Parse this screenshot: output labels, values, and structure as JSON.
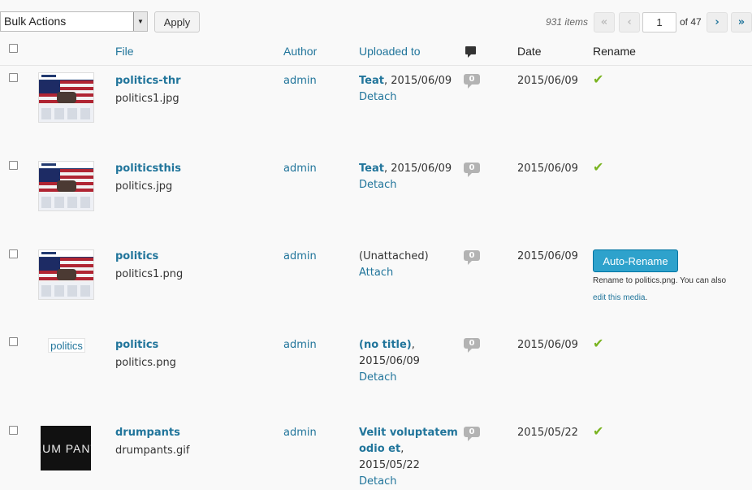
{
  "toolbar": {
    "bulk_actions": "Bulk Actions",
    "apply": "Apply",
    "items_count": "931 items",
    "first": "«",
    "prev": "‹",
    "current_page": "1",
    "of_total": "of 47",
    "next": "›",
    "last": "»"
  },
  "columns": {
    "file": "File",
    "author": "Author",
    "uploaded_to": "Uploaded to",
    "comments_icon": "comment-icon",
    "date": "Date",
    "rename": "Rename"
  },
  "rows": [
    {
      "title": "politics-thr",
      "filename": "politics1.jpg",
      "author": "admin",
      "uploaded_parent": "Teat",
      "uploaded_date": ", 2015/06/09",
      "uploaded_action": "Detach",
      "comments": "0",
      "date": "2015/06/09",
      "rename_status": "✔",
      "thumb": "politics-image"
    },
    {
      "title": "politicsthis",
      "filename": "politics.jpg",
      "author": "admin",
      "uploaded_parent": "Teat",
      "uploaded_date": ", 2015/06/09",
      "uploaded_action": "Detach",
      "comments": "0",
      "date": "2015/06/09",
      "rename_status": "✔",
      "thumb": "politics-image"
    },
    {
      "title": "politics",
      "filename": "politics1.png",
      "author": "admin",
      "uploaded_plain": "(Unattached)",
      "uploaded_action": "Attach",
      "comments": "0",
      "date": "2015/06/09",
      "rename_button": "Auto-Rename",
      "rename_note": "Rename to politics.png. You can also",
      "rename_link": "edit this media",
      "rename_link_suffix": ".",
      "thumb": "politics-image"
    },
    {
      "title": "politics",
      "filename": "politics.png",
      "author": "admin",
      "uploaded_parent": "(no title)",
      "uploaded_suffix": ",",
      "uploaded_date": "2015/06/09",
      "uploaded_action": "Detach",
      "comments": "0",
      "date": "2015/06/09",
      "rename_status": "✔",
      "thumb_text": "politics"
    },
    {
      "title": "drumpants",
      "filename": "drumpants.gif",
      "author": "admin",
      "uploaded_parent_line1": "Velit voluptatem",
      "uploaded_parent_line2": "odio et",
      "uploaded_date": ", 2015/05/22",
      "uploaded_action": "Detach",
      "comments": "0",
      "date": "2015/05/22",
      "rename_status": "✔",
      "thumb_dark_text": "RUM PANT"
    }
  ]
}
